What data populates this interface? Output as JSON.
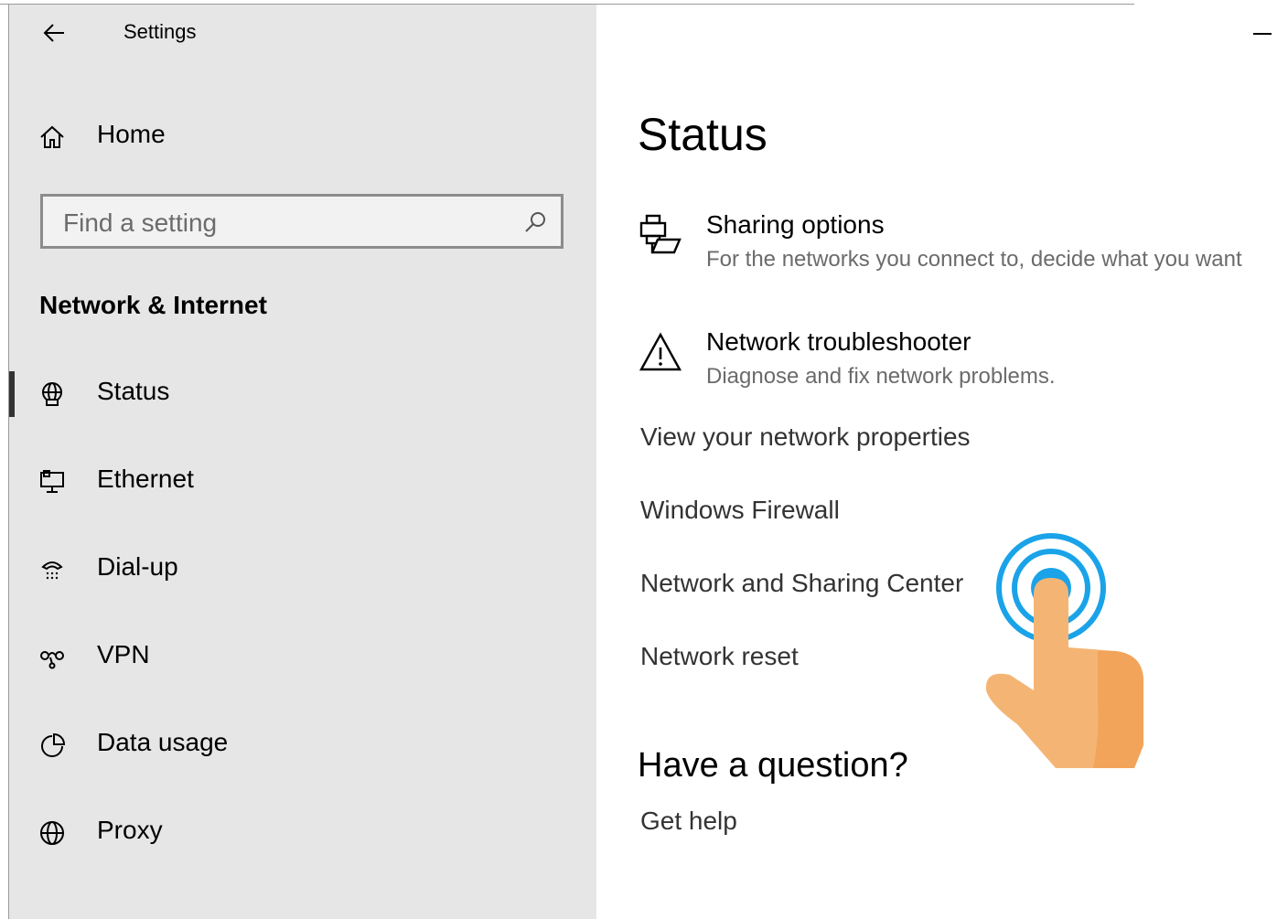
{
  "window": {
    "title": "Settings",
    "minimize_label": "Minimize"
  },
  "sidebar": {
    "home_label": "Home",
    "search": {
      "placeholder": "Find a setting",
      "value": ""
    },
    "section_title": "Network & Internet",
    "items": [
      {
        "label": "Status",
        "icon": "status-globe-icon",
        "selected": true
      },
      {
        "label": "Ethernet",
        "icon": "ethernet-icon",
        "selected": false
      },
      {
        "label": "Dial-up",
        "icon": "dialup-icon",
        "selected": false
      },
      {
        "label": "VPN",
        "icon": "vpn-icon",
        "selected": false
      },
      {
        "label": "Data usage",
        "icon": "data-usage-icon",
        "selected": false
      },
      {
        "label": "Proxy",
        "icon": "globe-icon",
        "selected": false
      }
    ]
  },
  "main": {
    "title": "Status",
    "options": [
      {
        "title": "Sharing options",
        "description": "For the networks you connect to, decide what you want",
        "icon": "sharing-icon"
      },
      {
        "title": "Network troubleshooter",
        "description": "Diagnose and fix network problems.",
        "icon": "warning-icon"
      }
    ],
    "links": [
      "View your network properties",
      "Windows Firewall",
      "Network and Sharing Center",
      "Network reset"
    ],
    "question_heading": "Have a question?",
    "help_link": "Get help"
  },
  "colors": {
    "sidebar_bg": "#e6e6e6",
    "accent_ring": "#1aa3e8",
    "hand": "#f4b574"
  }
}
